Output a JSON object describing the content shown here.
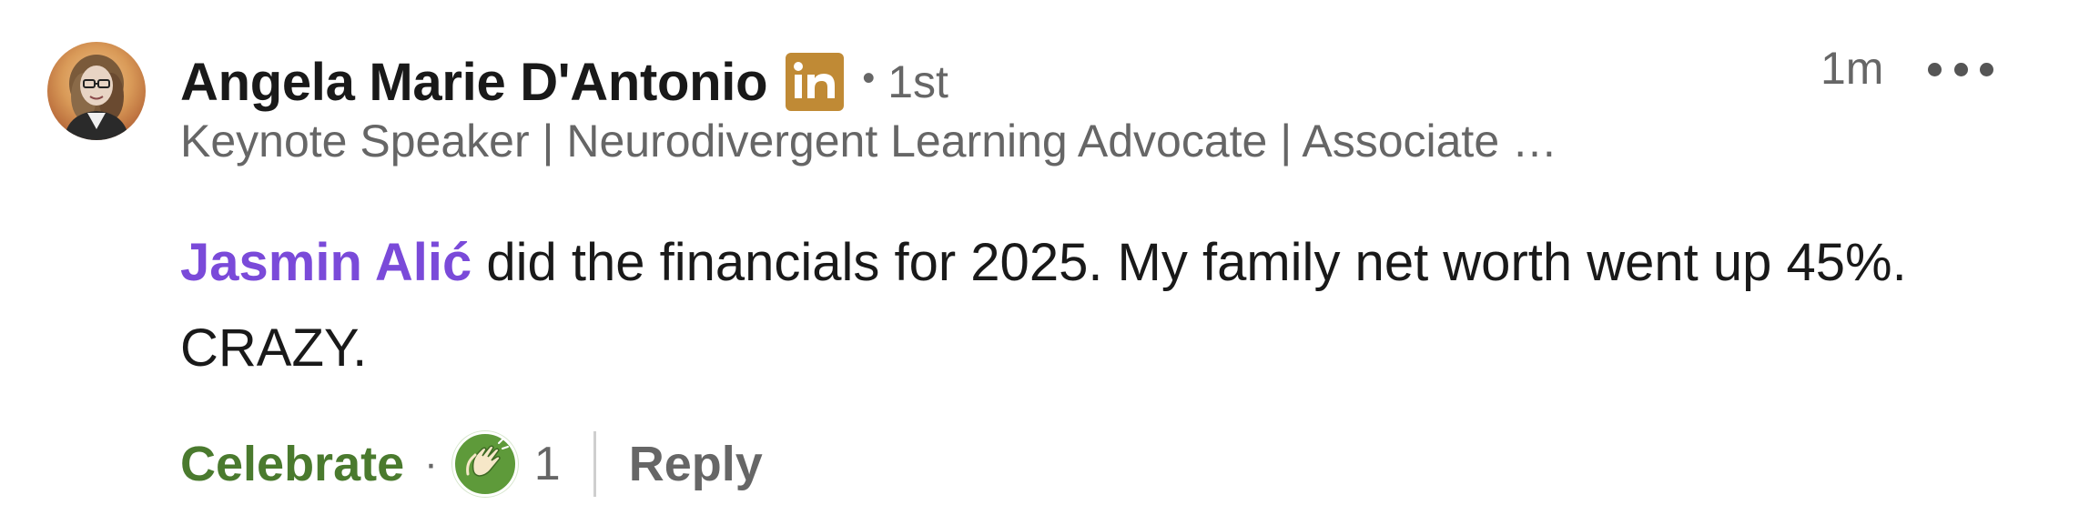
{
  "comment": {
    "author": {
      "name": "Angela Marie D'Antonio",
      "badge_icon": "linkedin-icon",
      "connection_degree": "1st",
      "headline": "Keynote Speaker | Neurodivergent Learning Advocate | Associate …",
      "avatar_icon": "profile-photo"
    },
    "timestamp": "1m",
    "more_icon": "ellipsis-icon",
    "body": {
      "mention": "Jasmin Alić",
      "text": " did the financials for 2025. My family net worth went up 45%. CRAZY."
    },
    "actions": {
      "reaction_label": "Celebrate",
      "separator": "·",
      "reaction_icon": "celebrate-clapping-hands-icon",
      "reaction_count": "1",
      "reply_label": "Reply"
    }
  },
  "colors": {
    "mention": "#7a4ad9",
    "celebrate": "#4a7a2e",
    "badge": "#c08a35",
    "secondary_text": "#666666",
    "primary_text": "#191919"
  }
}
